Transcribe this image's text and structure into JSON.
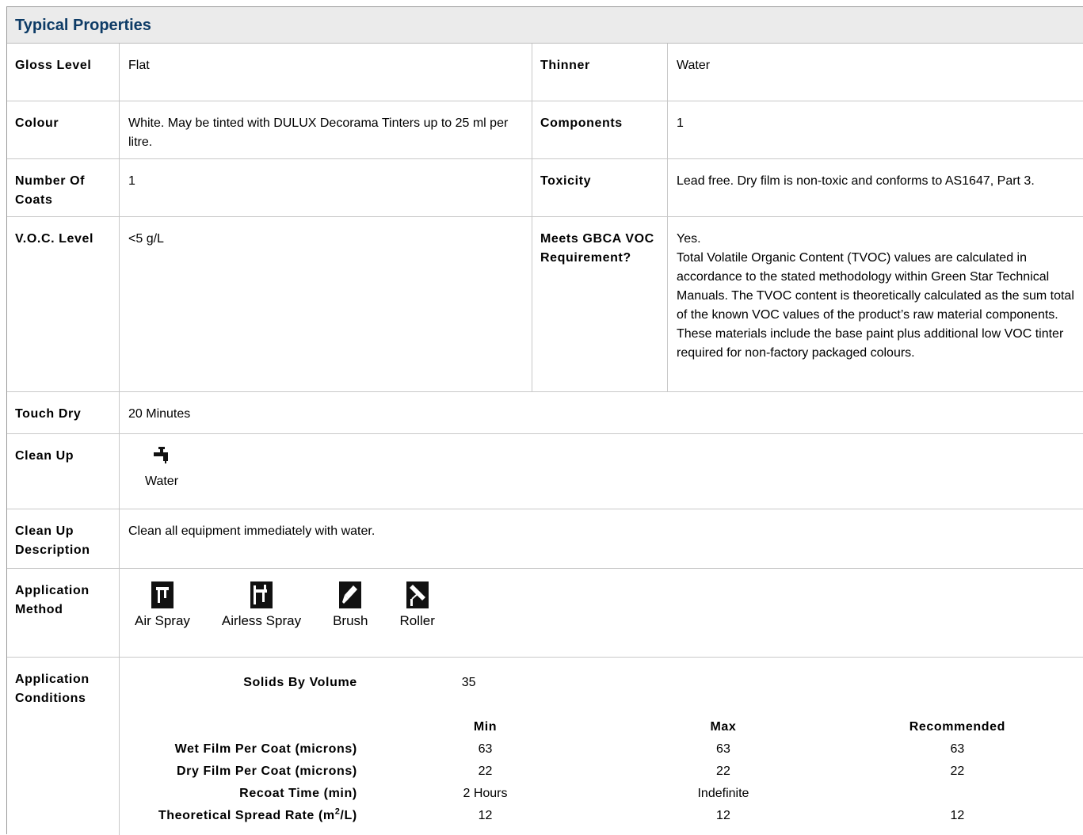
{
  "title": "Typical Properties",
  "rows": {
    "gloss": {
      "label": "Gloss Level",
      "value": "Flat"
    },
    "thinner": {
      "label": "Thinner",
      "value": "Water"
    },
    "colour": {
      "label": "Colour",
      "value": "White. May be tinted with DULUX Decorama Tinters up to 25 ml per litre."
    },
    "components": {
      "label": "Components",
      "value": "1"
    },
    "coats": {
      "label": "Number Of Coats",
      "value": "1"
    },
    "toxicity": {
      "label": "Toxicity",
      "value": "Lead free. Dry film is non-toxic and conforms to AS1647, Part 3."
    },
    "voc": {
      "label": "V.O.C. Level",
      "value": "<5 g/L"
    },
    "gbca": {
      "label": "Meets GBCA VOC Requirement?",
      "answer": "Yes.",
      "detail": "Total Volatile Organic Content (TVOC) values are calculated in accordance to the stated methodology within Green Star Technical Manuals. The TVOC content is theoretically calculated as the sum total of the known VOC values of the product’s raw material components. These materials include the base paint plus additional low VOC tinter required for non-factory packaged colours."
    },
    "touch_dry": {
      "label": "Touch Dry",
      "value": "20 Minutes"
    },
    "clean_up": {
      "label": "Clean Up",
      "icon": "water-tap-icon",
      "value": "Water"
    },
    "clean_up_desc": {
      "label": "Clean Up Description",
      "value": "Clean all equipment immediately with water."
    },
    "application_method": {
      "label": "Application Method",
      "methods": [
        {
          "icon": "air-spray-icon",
          "label": "Air Spray"
        },
        {
          "icon": "airless-spray-icon",
          "label": "Airless Spray"
        },
        {
          "icon": "brush-icon",
          "label": "Brush"
        },
        {
          "icon": "roller-icon",
          "label": "Roller"
        }
      ]
    },
    "application_conditions": {
      "label": "Application Conditions",
      "solids_label": "Solids By Volume",
      "solids_value": "35",
      "headers": {
        "min": "Min",
        "max": "Max",
        "recommended": "Recommended"
      },
      "items": [
        {
          "label": "Wet Film Per Coat (microns)",
          "min": "63",
          "max": "63",
          "rec": "63"
        },
        {
          "label": "Dry Film Per Coat (microns)",
          "min": "22",
          "max": "22",
          "rec": "22"
        },
        {
          "label": "Recoat Time (min)",
          "min": "2 Hours",
          "max": "Indefinite",
          "rec": ""
        },
        {
          "label_pre": "Theoretical Spread Rate (m",
          "label_sup": "2",
          "label_post": "/L)",
          "min": "12",
          "max": "12",
          "rec": "12"
        }
      ]
    }
  }
}
